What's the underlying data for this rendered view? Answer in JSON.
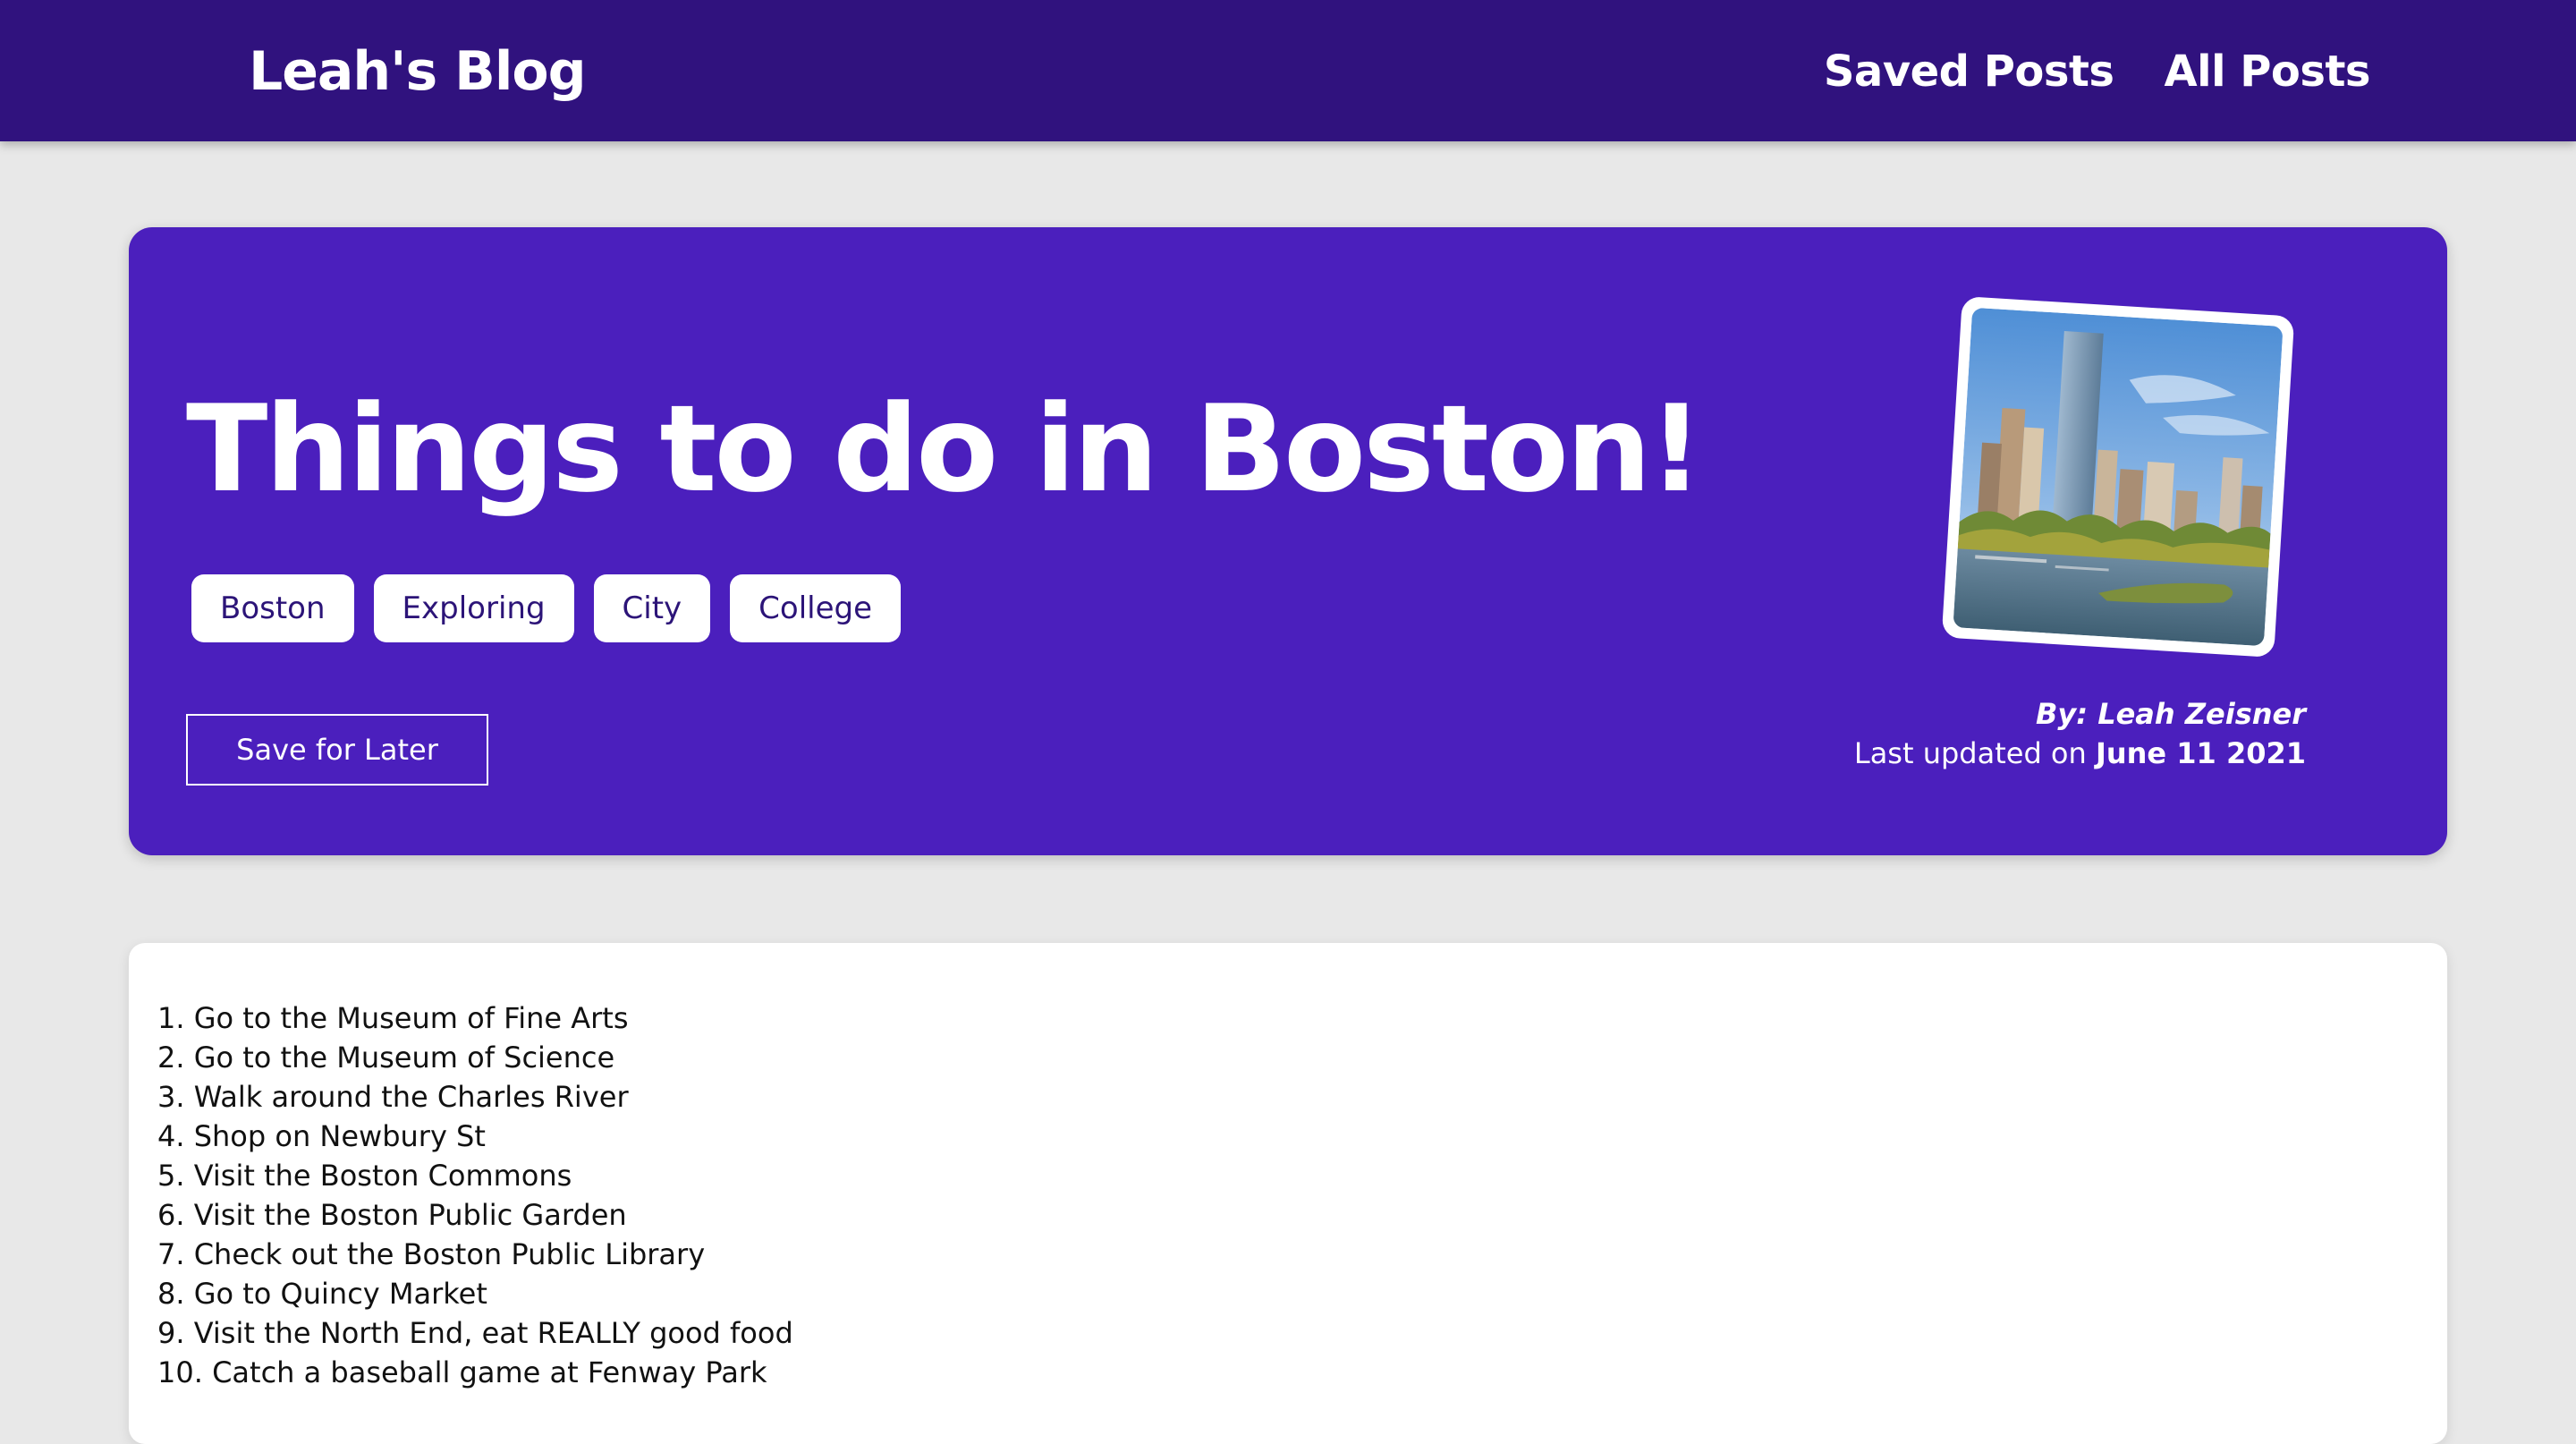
{
  "nav": {
    "brand": "Leah's Blog",
    "links": [
      "Saved Posts",
      "All Posts"
    ]
  },
  "post": {
    "title": "Things to do in Boston!",
    "tags": [
      "Boston",
      "Exploring",
      "City",
      "College"
    ],
    "save_label": "Save for Later",
    "byline_prefix": "By:",
    "author": "Leah Zeisner",
    "updated_prefix": "Last updated on",
    "updated_date": "June 11 2021",
    "image": "boston-skyline-photo",
    "items": [
      "1. Go to the Museum of Fine Arts",
      "2. Go to the Museum of Science",
      "3. Walk around the Charles River",
      "4. Shop on Newbury St",
      "5. Visit the Boston Commons",
      "6. Visit the Boston Public Garden",
      "7. Check out the Boston Public Library",
      "8. Go to Quincy Market",
      "9. Visit the North End, eat REALLY good food",
      "10. Catch a baseball game at Fenway Park"
    ]
  },
  "colors": {
    "navbar": "#30127e",
    "hero": "#4b1fbd",
    "background": "#e8e8e8",
    "tag_text": "#2c1478"
  }
}
